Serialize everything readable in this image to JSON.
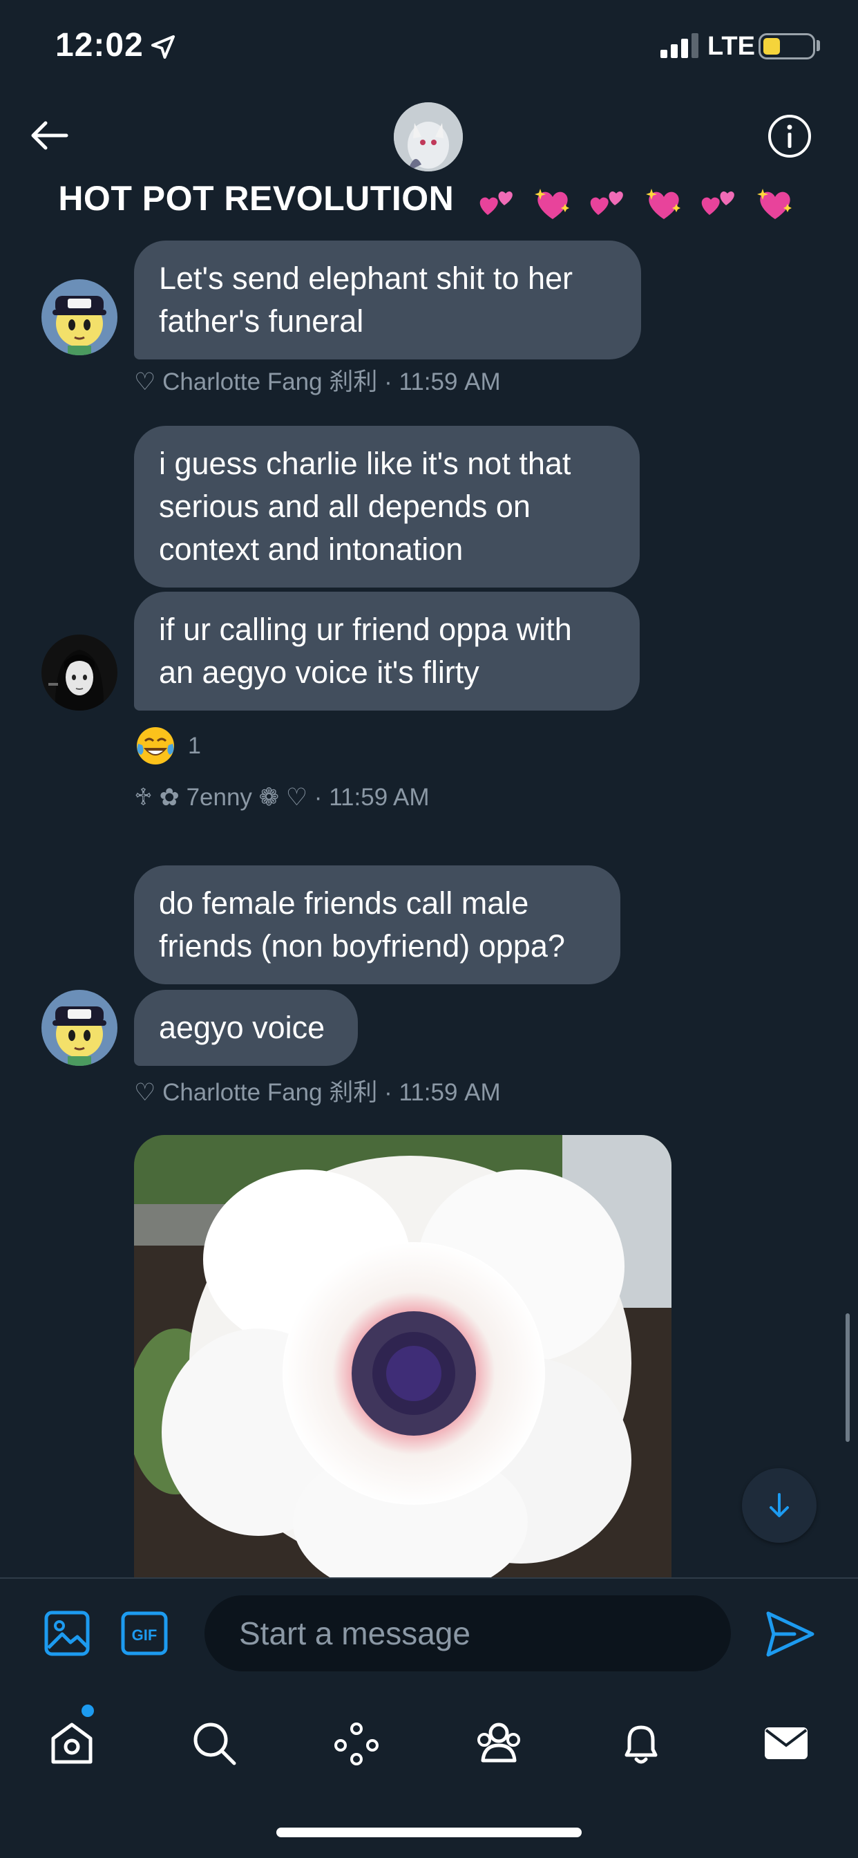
{
  "status_bar": {
    "time": "12:02",
    "network": "LTE"
  },
  "header": {
    "title": "HOT POT REVOLUTION"
  },
  "messages": [
    {
      "lines": [
        "Let's send elephant shit to her",
        "father's funeral"
      ],
      "meta": "♡ Charlotte Fang 刹利 · 11:59 AM"
    },
    {
      "lines_a": [
        "i guess charlie like it's not that",
        "serious and all depends on",
        "context and intonation"
      ],
      "lines_b": [
        "if ur calling ur friend oppa with",
        "an aegyo voice it's flirty"
      ],
      "reaction_count": "1",
      "meta": "♱ ✿ 7enny ❁ ♡ · 11:59 AM"
    },
    {
      "lines_a": [
        "do female friends call male",
        "friends (non boyfriend) oppa?"
      ],
      "lines_b": [
        "aegyo voice"
      ],
      "meta": "♡ Charlotte Fang 刹利 · 11:59 AM"
    }
  ],
  "composer": {
    "placeholder": "Start a message"
  },
  "tabs": [
    "home-icon",
    "search-icon",
    "spaces-icon",
    "communities-icon",
    "notifications-icon",
    "messages-icon"
  ],
  "colors": {
    "background": "#15202b",
    "bubble": "#424e5d",
    "accent": "#1d9bf0",
    "meta": "#8b98a5"
  }
}
